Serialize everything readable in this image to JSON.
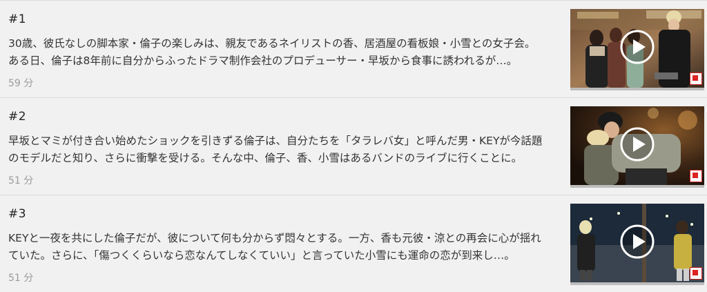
{
  "episodes": [
    {
      "number": "#1",
      "description_lines": [
        "30歳、彼氏なしの脚本家・倫子の楽しみは、親友であるネイリストの香、居酒屋の看板娘・小雪との女子会。",
        "ある日、倫子は8年前に自分からふったドラマ制作会社のプロデューサー・早坂から食事に誘われるが…。"
      ],
      "duration": "59 分",
      "thumbnail_icon": "play-icon"
    },
    {
      "number": "#2",
      "description_lines": [
        "早坂とマミが付き合い始めたショックを引きずる倫子は、自分たちを「タラレバ女」と呼んだ男・KEYが今話題",
        "のモデルだと知り、さらに衝撃を受ける。そんな中、倫子、香、小雪はあるバンドのライブに行くことに。"
      ],
      "duration": "51 分",
      "thumbnail_icon": "play-icon"
    },
    {
      "number": "#3",
      "description_lines": [
        "KEYと一夜を共にした倫子だが、彼について何も分からず悶々とする。一方、香も元彼・涼との再会に心が揺れ",
        "ていた。さらに、「傷つくくらいなら恋なんてしなくていい」と言っていた小雪にも運命の恋が到来し…。"
      ],
      "duration": "51 分",
      "thumbnail_icon": "play-icon"
    }
  ]
}
